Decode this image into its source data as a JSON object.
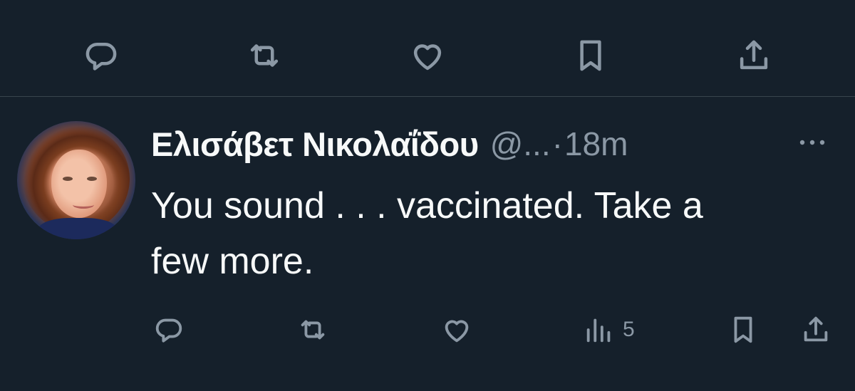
{
  "top_actions": {
    "reply_icon": "reply-icon",
    "retweet_icon": "retweet-icon",
    "like_icon": "heart-icon",
    "bookmark_icon": "bookmark-icon",
    "share_icon": "share-icon"
  },
  "reply_tweet": {
    "display_name": "Ελισάβετ Νικολαΐδου",
    "handle": "@...",
    "separator": "·",
    "time": "18m",
    "text": "You sound . . . vaccinated. Take a\nfew more.",
    "views_count": "5"
  },
  "colors": {
    "background": "#15202b",
    "primary_text": "#f7f9f9",
    "secondary_text": "#8b98a5",
    "divider": "#38444d"
  }
}
